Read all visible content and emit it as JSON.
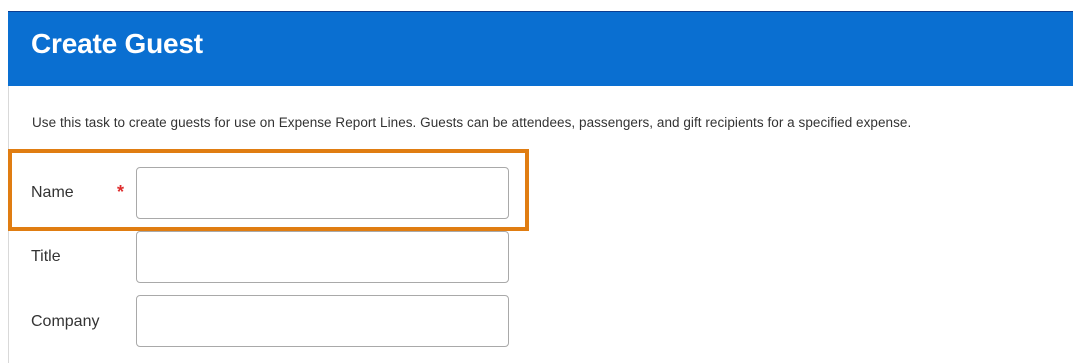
{
  "header": {
    "title": "Create Guest"
  },
  "description": "Use this task to create guests for use on Expense Report Lines. Guests can be attendees, passengers, and gift recipients for a specified expense.",
  "fields": [
    {
      "label": "Name",
      "required": true,
      "required_marker": "*",
      "value": "",
      "placeholder": ""
    },
    {
      "label": "Title",
      "required": false,
      "value": "",
      "placeholder": ""
    },
    {
      "label": "Company",
      "required": false,
      "value": "",
      "placeholder": ""
    }
  ],
  "colors": {
    "header_bg": "#0a6fd1",
    "highlight": "#e07d12",
    "required": "#de2c2c"
  }
}
